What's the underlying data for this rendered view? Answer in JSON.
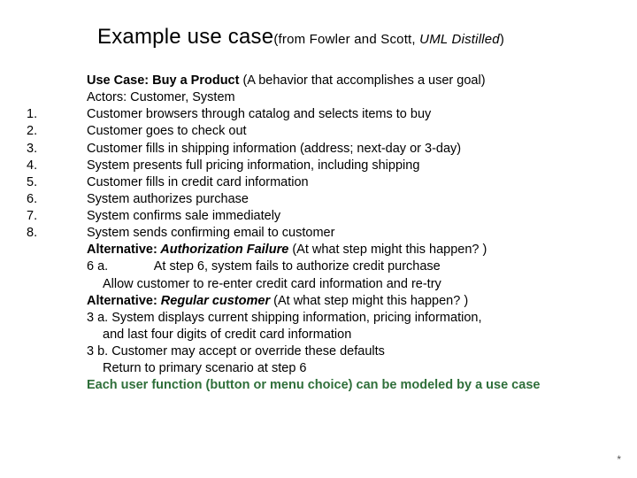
{
  "title": {
    "main": "Example use case",
    "sub_prefix": "(from Fowler and Scott, ",
    "book": "UML Distilled",
    "sub_suffix": ")"
  },
  "header": {
    "uc_label": "Use Case: Buy a Product",
    "uc_desc": " (A behavior that accomplishes a user goal)",
    "actors": "Actors: Customer, System"
  },
  "steps": {
    "n1": "1.",
    "n2": "2.",
    "n3": "3.",
    "n4": "4.",
    "n5": "5.",
    "n6": "6.",
    "n7": "7.",
    "n8": "8.",
    "s1": "Customer browsers through catalog and selects items to buy",
    "s2": "Customer goes to check out",
    "s3": "Customer fills in shipping information (address; next-day or 3-day)",
    "s4": "System presents full pricing information, including shipping",
    "s5": "Customer fills in credit card information",
    "s6": "System authorizes purchase",
    "s7": "System confirms sale immediately",
    "s8": "System sends confirming email to customer"
  },
  "alt1": {
    "label": "Alternative:",
    "name": " Authorization Failure ",
    "q": " (At what step might this happen? )",
    "line_6a_pre": "6 a.             ",
    "line_6a": "At step 6, system fails to authorize credit purchase",
    "line_allow": "Allow customer to re-enter credit card information and re-try"
  },
  "alt2": {
    "label": "Alternative:",
    "name": " Regular customer",
    "q": " (At what step might this happen? )",
    "l3a": "3 a. System displays current shipping information, pricing information,",
    "l3a_cont": "and last four digits of credit card information",
    "l3b": "3 b. Customer may accept or override these defaults",
    "ret": "Return to primary scenario at step 6"
  },
  "footer_line": "Each user function (button or menu choice) can be modeled by a use case",
  "star": "*"
}
